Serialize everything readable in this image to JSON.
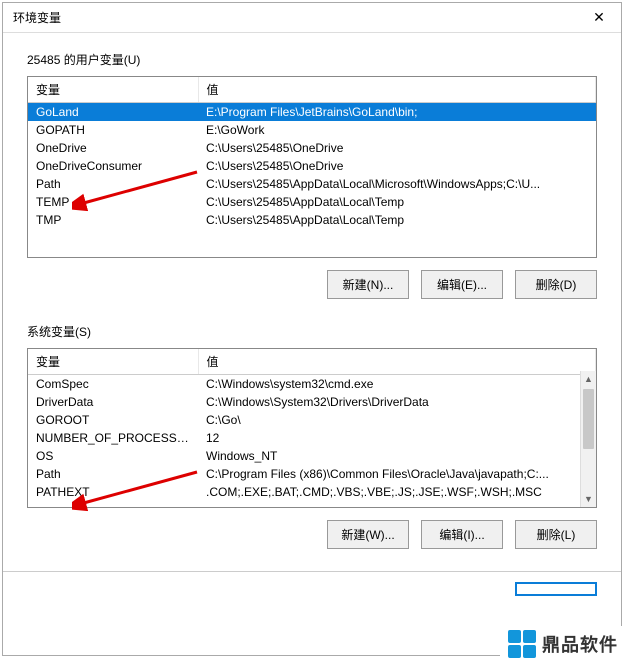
{
  "window": {
    "title": "环境变量"
  },
  "user_section": {
    "label": "25485 的用户变量(U)"
  },
  "user_table": {
    "col_var": "变量",
    "col_val": "值",
    "rows": [
      {
        "name": "GoLand",
        "value": "E:\\Program Files\\JetBrains\\GoLand\\bin;",
        "selected": true
      },
      {
        "name": "GOPATH",
        "value": "E:\\GoWork"
      },
      {
        "name": "OneDrive",
        "value": "C:\\Users\\25485\\OneDrive"
      },
      {
        "name": "OneDriveConsumer",
        "value": "C:\\Users\\25485\\OneDrive"
      },
      {
        "name": "Path",
        "value": "C:\\Users\\25485\\AppData\\Local\\Microsoft\\WindowsApps;C:\\U..."
      },
      {
        "name": "TEMP",
        "value": "C:\\Users\\25485\\AppData\\Local\\Temp"
      },
      {
        "name": "TMP",
        "value": "C:\\Users\\25485\\AppData\\Local\\Temp"
      }
    ]
  },
  "user_buttons": {
    "new": "新建(N)...",
    "edit": "编辑(E)...",
    "del": "删除(D)"
  },
  "sys_section": {
    "label": "系统变量(S)"
  },
  "sys_table": {
    "col_var": "变量",
    "col_val": "值",
    "rows": [
      {
        "name": "ComSpec",
        "value": "C:\\Windows\\system32\\cmd.exe"
      },
      {
        "name": "DriverData",
        "value": "C:\\Windows\\System32\\Drivers\\DriverData"
      },
      {
        "name": "GOROOT",
        "value": "C:\\Go\\"
      },
      {
        "name": "NUMBER_OF_PROCESSORS",
        "value": "12"
      },
      {
        "name": "OS",
        "value": "Windows_NT"
      },
      {
        "name": "Path",
        "value": "C:\\Program Files (x86)\\Common Files\\Oracle\\Java\\javapath;C:..."
      },
      {
        "name": "PATHEXT",
        "value": ".COM;.EXE;.BAT;.CMD;.VBS;.VBE;.JS;.JSE;.WSF;.WSH;.MSC"
      }
    ]
  },
  "sys_buttons": {
    "new": "新建(W)...",
    "edit": "编辑(I)...",
    "del": "删除(L)"
  },
  "watermark": {
    "text": "鼎品软件"
  }
}
